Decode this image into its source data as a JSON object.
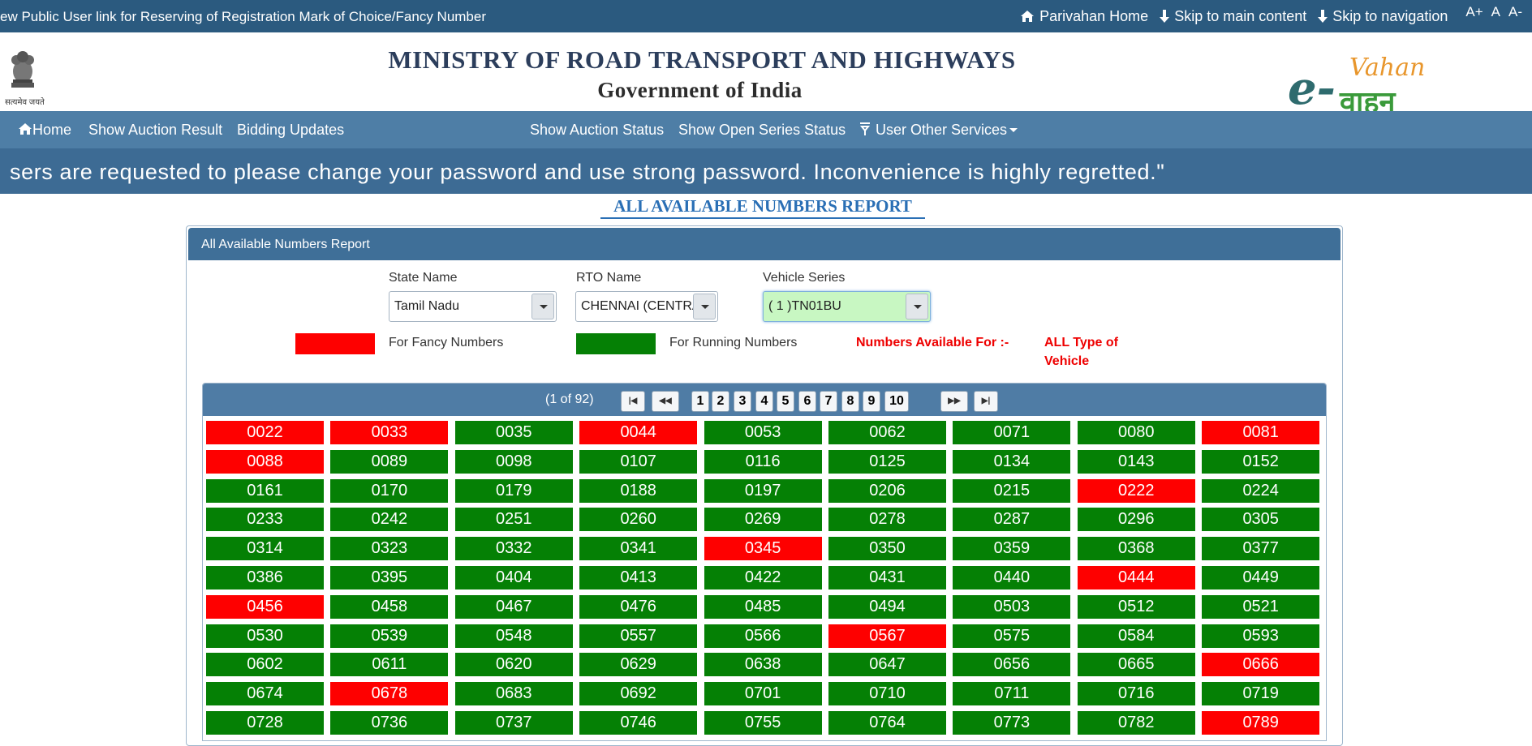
{
  "topbar": {
    "marquee": "ew Public User link for Reserving of Registration Mark of Choice/Fancy Number",
    "parivahan_home": "Parivahan Home",
    "skip_main": "Skip to main content",
    "skip_nav": "Skip to navigation",
    "font_increase": "A+",
    "font_normal": "A",
    "font_decrease": "A-"
  },
  "header": {
    "emblem_text": "सत्यमेव जयते",
    "title": "MINISTRY OF ROAD TRANSPORT AND HIGHWAYS",
    "subtitle": "Government of India",
    "logo_e": "e-",
    "logo_vahan": "Vahan",
    "logo_hindi": "वाहन"
  },
  "nav": {
    "home": "Home",
    "auction_result": "Show Auction Result",
    "bidding_updates": "Bidding Updates",
    "auction_status": "Show Auction Status",
    "open_series": "Show Open Series Status",
    "other_services": "User Other Services"
  },
  "notice": "sers are requested to please change your password and use strong password. Inconvenience is highly regretted.\"",
  "report_title": "ALL AVAILABLE NUMBERS REPORT",
  "panel": {
    "heading": "All Available Numbers Report",
    "state_label": "State Name",
    "state_value": "Tamil Nadu",
    "rto_label": "RTO Name",
    "rto_value": "CHENNAI (CENTRAL)",
    "series_label": "Vehicle Series",
    "series_value": "( 1 )TN01BU",
    "legend_fancy": "For Fancy Numbers",
    "legend_running": "For Running Numbers",
    "avail_label": "Numbers Available For :-",
    "avail_line1": "ALL Type of",
    "avail_line2": "Vehicle",
    "colors": {
      "fancy": "#fe0000",
      "running": "#058005"
    }
  },
  "pager": {
    "count": "(1 of 92)",
    "pages": [
      "1",
      "2",
      "3",
      "4",
      "5",
      "6",
      "7",
      "8",
      "9",
      "10"
    ]
  },
  "numbers": [
    [
      "0022",
      "r"
    ],
    [
      "0033",
      "r"
    ],
    [
      "0035",
      "g"
    ],
    [
      "0044",
      "r"
    ],
    [
      "0053",
      "g"
    ],
    [
      "0062",
      "g"
    ],
    [
      "0071",
      "g"
    ],
    [
      "0080",
      "g"
    ],
    [
      "0081",
      "r"
    ],
    [
      "0088",
      "r"
    ],
    [
      "0089",
      "g"
    ],
    [
      "0098",
      "g"
    ],
    [
      "0107",
      "g"
    ],
    [
      "0116",
      "g"
    ],
    [
      "0125",
      "g"
    ],
    [
      "0134",
      "g"
    ],
    [
      "0143",
      "g"
    ],
    [
      "0152",
      "g"
    ],
    [
      "0161",
      "g"
    ],
    [
      "0170",
      "g"
    ],
    [
      "0179",
      "g"
    ],
    [
      "0188",
      "g"
    ],
    [
      "0197",
      "g"
    ],
    [
      "0206",
      "g"
    ],
    [
      "0215",
      "g"
    ],
    [
      "0222",
      "r"
    ],
    [
      "0224",
      "g"
    ],
    [
      "0233",
      "g"
    ],
    [
      "0242",
      "g"
    ],
    [
      "0251",
      "g"
    ],
    [
      "0260",
      "g"
    ],
    [
      "0269",
      "g"
    ],
    [
      "0278",
      "g"
    ],
    [
      "0287",
      "g"
    ],
    [
      "0296",
      "g"
    ],
    [
      "0305",
      "g"
    ],
    [
      "0314",
      "g"
    ],
    [
      "0323",
      "g"
    ],
    [
      "0332",
      "g"
    ],
    [
      "0341",
      "g"
    ],
    [
      "0345",
      "r"
    ],
    [
      "0350",
      "g"
    ],
    [
      "0359",
      "g"
    ],
    [
      "0368",
      "g"
    ],
    [
      "0377",
      "g"
    ],
    [
      "0386",
      "g"
    ],
    [
      "0395",
      "g"
    ],
    [
      "0404",
      "g"
    ],
    [
      "0413",
      "g"
    ],
    [
      "0422",
      "g"
    ],
    [
      "0431",
      "g"
    ],
    [
      "0440",
      "g"
    ],
    [
      "0444",
      "r"
    ],
    [
      "0449",
      "g"
    ],
    [
      "0456",
      "r"
    ],
    [
      "0458",
      "g"
    ],
    [
      "0467",
      "g"
    ],
    [
      "0476",
      "g"
    ],
    [
      "0485",
      "g"
    ],
    [
      "0494",
      "g"
    ],
    [
      "0503",
      "g"
    ],
    [
      "0512",
      "g"
    ],
    [
      "0521",
      "g"
    ],
    [
      "0530",
      "g"
    ],
    [
      "0539",
      "g"
    ],
    [
      "0548",
      "g"
    ],
    [
      "0557",
      "g"
    ],
    [
      "0566",
      "g"
    ],
    [
      "0567",
      "r"
    ],
    [
      "0575",
      "g"
    ],
    [
      "0584",
      "g"
    ],
    [
      "0593",
      "g"
    ],
    [
      "0602",
      "g"
    ],
    [
      "0611",
      "g"
    ],
    [
      "0620",
      "g"
    ],
    [
      "0629",
      "g"
    ],
    [
      "0638",
      "g"
    ],
    [
      "0647",
      "g"
    ],
    [
      "0656",
      "g"
    ],
    [
      "0665",
      "g"
    ],
    [
      "0666",
      "r"
    ],
    [
      "0674",
      "g"
    ],
    [
      "0678",
      "r"
    ],
    [
      "0683",
      "g"
    ],
    [
      "0692",
      "g"
    ],
    [
      "0701",
      "g"
    ],
    [
      "0710",
      "g"
    ],
    [
      "0711",
      "g"
    ],
    [
      "0716",
      "g"
    ],
    [
      "0719",
      "g"
    ],
    [
      "0728",
      "g"
    ],
    [
      "0736",
      "g"
    ],
    [
      "0737",
      "g"
    ],
    [
      "0746",
      "g"
    ],
    [
      "0755",
      "g"
    ],
    [
      "0764",
      "g"
    ],
    [
      "0773",
      "g"
    ],
    [
      "0782",
      "g"
    ],
    [
      "0789",
      "r"
    ]
  ]
}
